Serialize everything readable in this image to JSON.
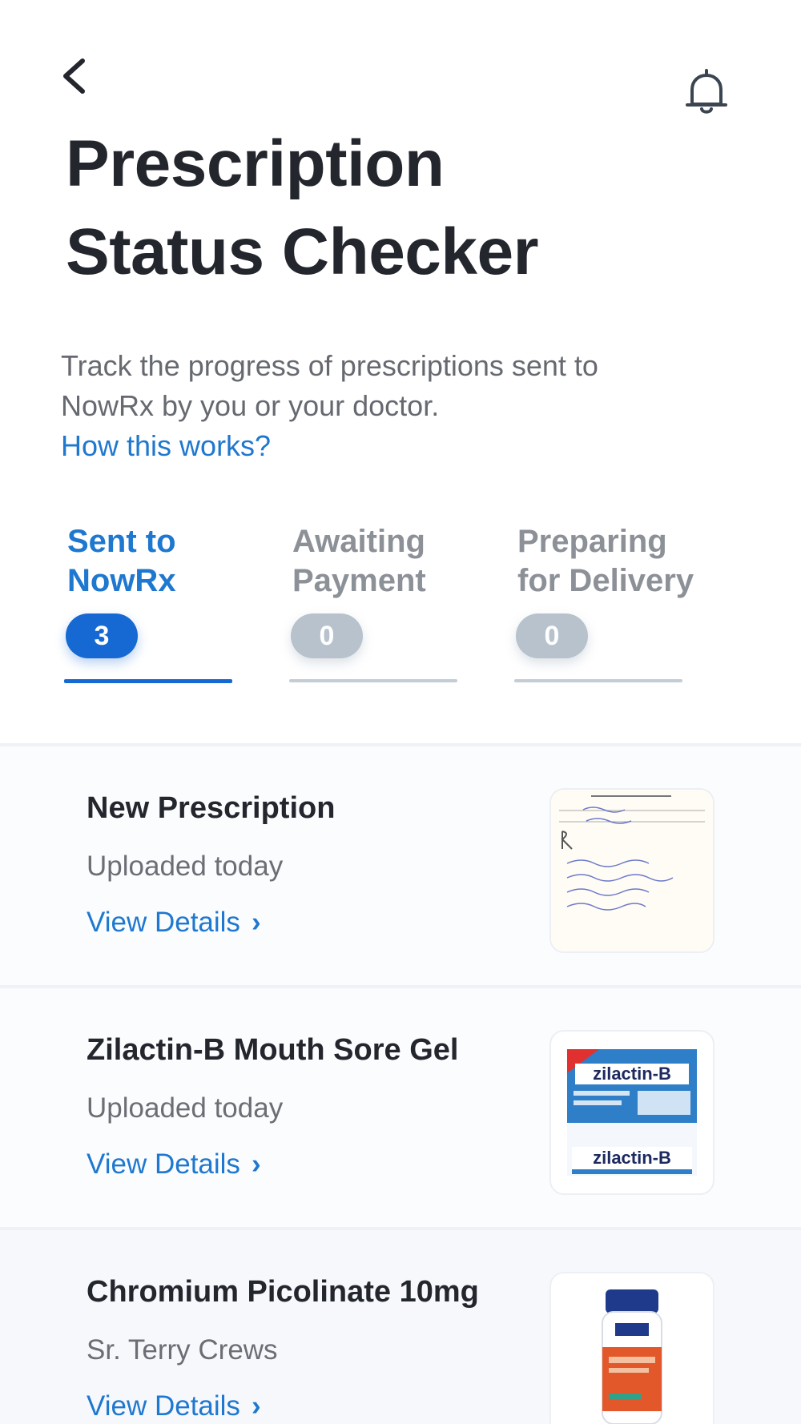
{
  "header": {
    "title_line1": "Prescription",
    "title_line2": "Status Checker",
    "description": "Track the progress of prescriptions sent to NowRx by you or your doctor.",
    "how_link": "How this works?"
  },
  "icons": {
    "back": "chevron-left-icon",
    "notifications": "bell-icon"
  },
  "colors": {
    "accent": "#1669d2",
    "link": "#1f78cf",
    "inactive_badge": "#b7c2cd",
    "text": "#23262d",
    "muted": "#6b6f75"
  },
  "tabs": [
    {
      "label_line1": "Sent to",
      "label_line2": "NowRx",
      "count": "3",
      "active": true
    },
    {
      "label_line1": "Awaiting",
      "label_line2": "Payment",
      "count": "0",
      "active": false
    },
    {
      "label_line1": "Preparing",
      "label_line2": "for Delivery",
      "count": "0",
      "active": false
    }
  ],
  "prescriptions": [
    {
      "name": "New Prescription",
      "subtitle": "Uploaded today",
      "link": "View Details",
      "image": "handwritten-rx-note"
    },
    {
      "name": "Zilactin-B Mouth Sore Gel",
      "subtitle": "Uploaded today",
      "link": "View Details",
      "image": "zilactin-b-box",
      "image_text": "zilactin-B"
    },
    {
      "name": "Chromium Picolinate 10mg",
      "subtitle": "Sr. Terry Crews",
      "link": "View Details",
      "image": "supplement-bottle"
    }
  ]
}
